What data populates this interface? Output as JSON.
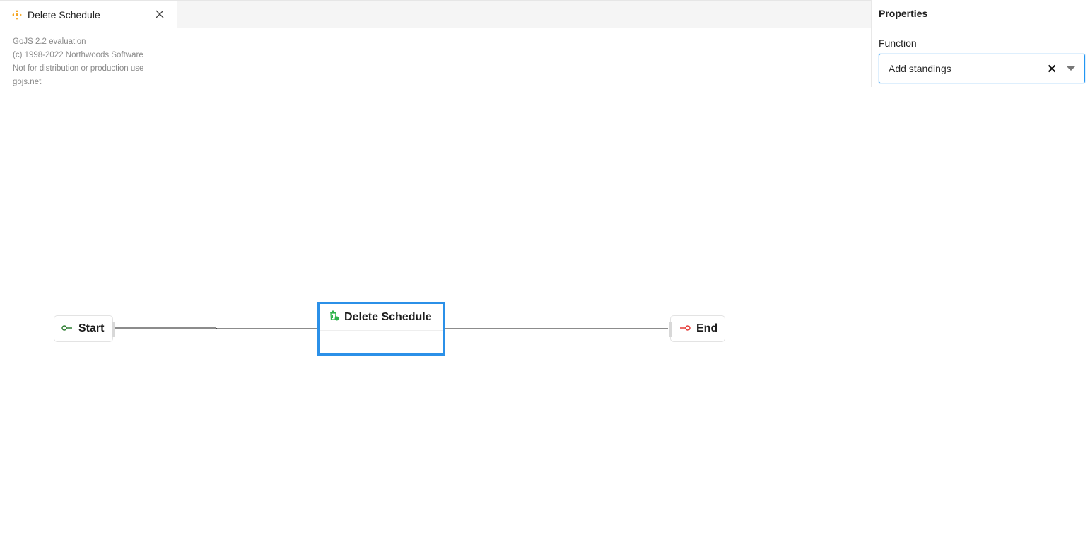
{
  "tab": {
    "title": "Delete Schedule",
    "icon": "diamond-arrows-icon",
    "close_icon": "close-icon"
  },
  "watermark": {
    "line1": "GoJS 2.2 evaluation",
    "line2": "(c) 1998-2022 Northwoods Software",
    "line3": "Not for distribution or production use",
    "line4": "gojs.net"
  },
  "properties": {
    "title": "Properties",
    "function_label": "Function",
    "function_value": "Add standings",
    "clear_icon": "clear-icon",
    "dropdown_icon": "chevron-down-icon"
  },
  "diagram": {
    "start": {
      "label": "Start",
      "icon": "start-key-icon",
      "color": "#2e7d32"
    },
    "task": {
      "label": "Delete Schedule",
      "icon": "trash-icon",
      "color": "#2eb34a",
      "selected_color": "#2b90e8"
    },
    "end": {
      "label": "End",
      "icon": "end-key-icon",
      "color": "#e53935"
    }
  },
  "colors": {
    "accent": "#2196f3",
    "app_icon": "#f5a623"
  }
}
